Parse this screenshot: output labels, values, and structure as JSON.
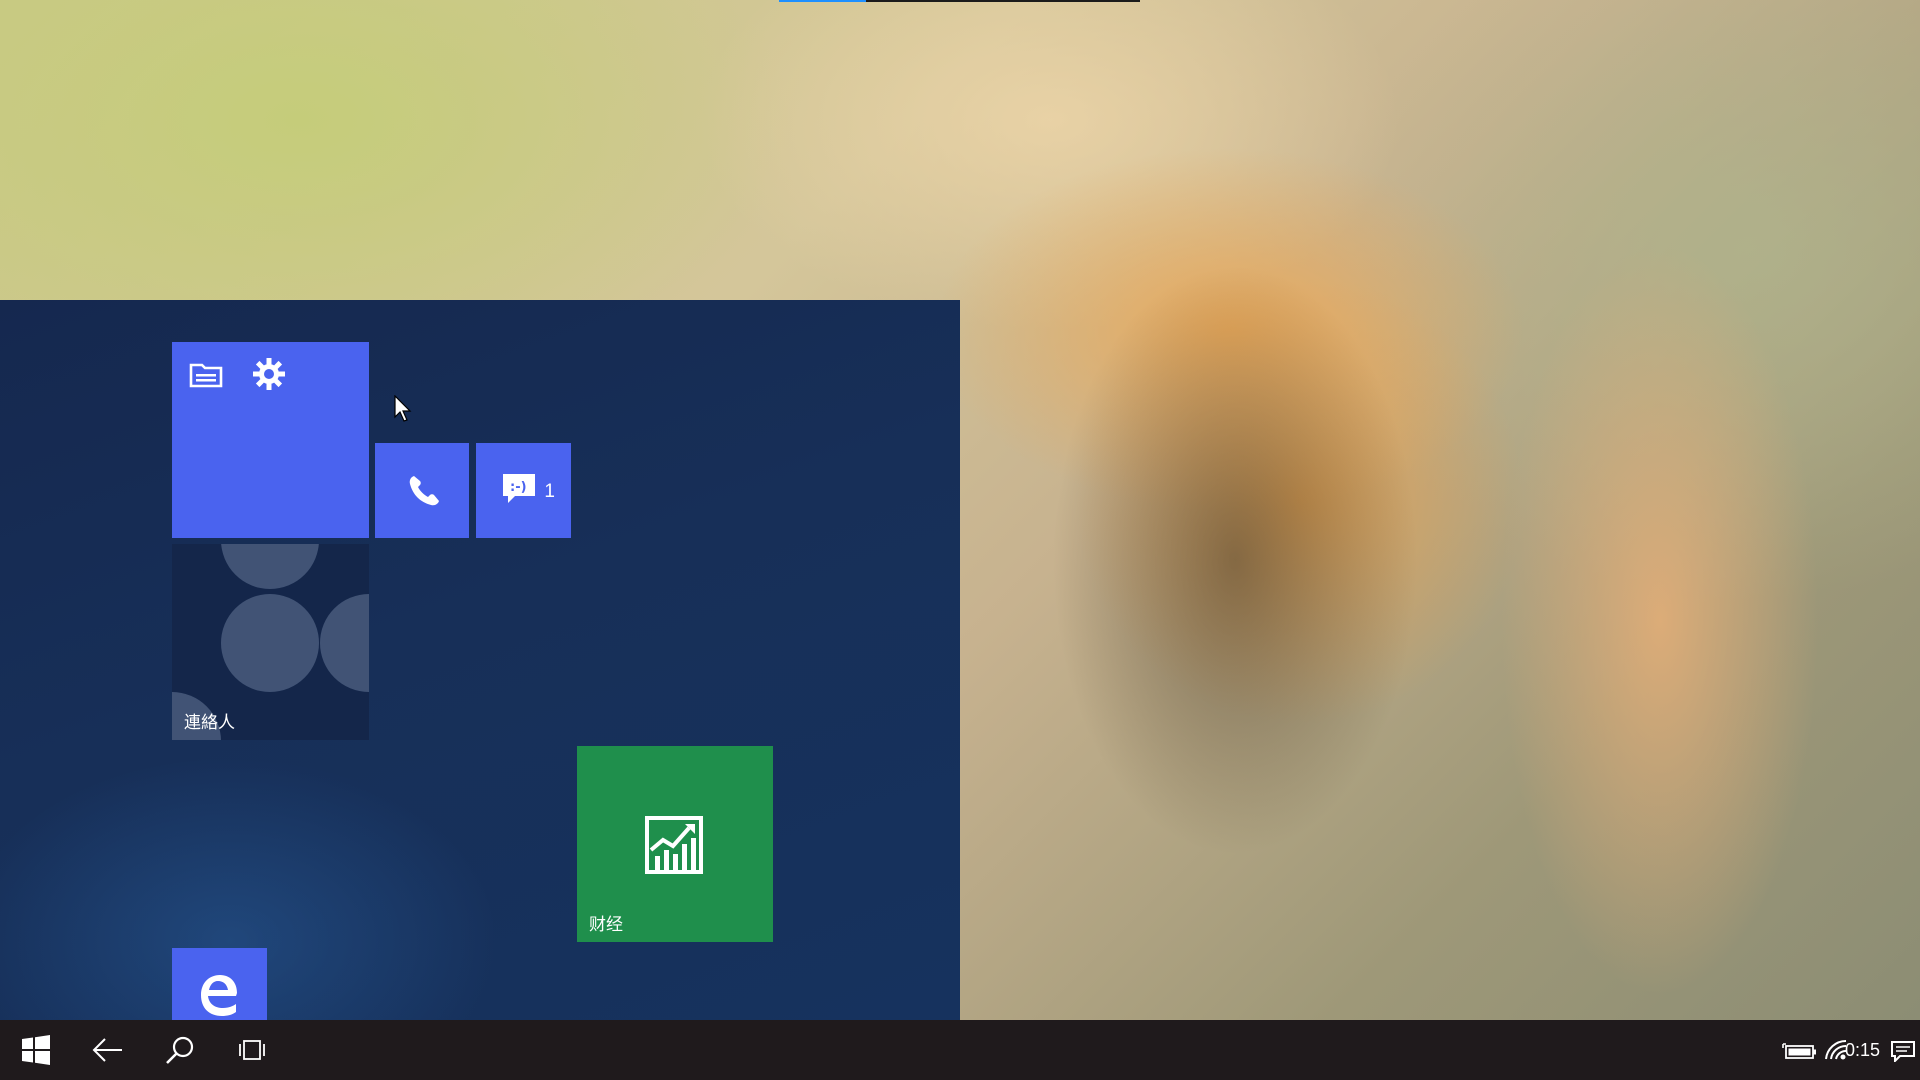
{
  "top_progress": {
    "value_percent": 24,
    "color": "#1e90ff"
  },
  "start": {
    "tiles": {
      "settings_group": {
        "icons": [
          "file-explorer-icon",
          "gear-icon"
        ]
      },
      "phone": {
        "icon": "phone-icon"
      },
      "messaging": {
        "icon": "message-icon",
        "count": "1"
      },
      "contacts": {
        "label": "連絡人"
      },
      "finance": {
        "label": "财经",
        "icon": "chart-icon"
      },
      "edge": {
        "icon": "edge-icon"
      }
    },
    "accent_color": "#4a63ef",
    "finance_color": "#1f8f4c"
  },
  "taskbar": {
    "buttons": [
      "windows-start-icon",
      "back-arrow-icon",
      "search-icon",
      "task-view-icon"
    ],
    "tray": [
      "battery-icon",
      "wifi-icon",
      "notification-icon"
    ],
    "clock": "0:15"
  }
}
